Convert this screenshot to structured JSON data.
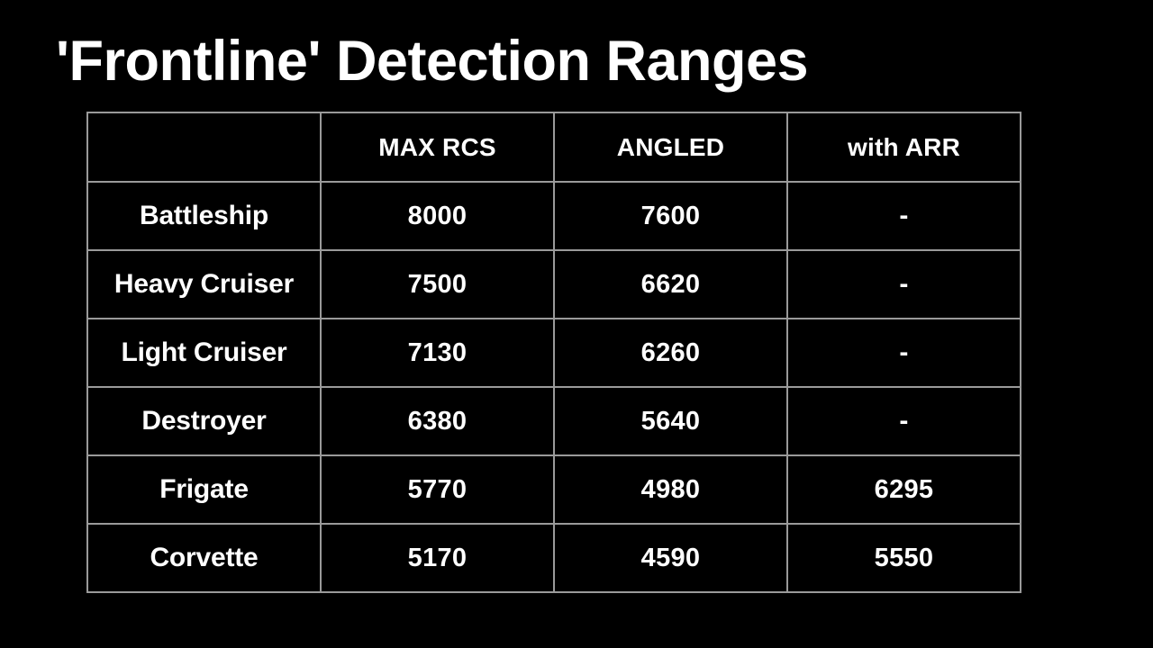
{
  "slide": {
    "title": "'Frontline' Detection Ranges",
    "background_color": "#000000",
    "text_color": "#ffffff",
    "table_border_color": "#9a9a9a"
  },
  "table": {
    "headers": [
      "",
      "MAX RCS",
      "ANGLED",
      "with ARR"
    ],
    "rows": [
      {
        "label": "Battleship",
        "max_rcs": "8000",
        "angled": "7600",
        "with_arr": "-"
      },
      {
        "label": "Heavy Cruiser",
        "max_rcs": "7500",
        "angled": "6620",
        "with_arr": "-"
      },
      {
        "label": "Light Cruiser",
        "max_rcs": "7130",
        "angled": "6260",
        "with_arr": "-"
      },
      {
        "label": "Destroyer",
        "max_rcs": "6380",
        "angled": "5640",
        "with_arr": "-"
      },
      {
        "label": "Frigate",
        "max_rcs": "5770",
        "angled": "4980",
        "with_arr": "6295"
      },
      {
        "label": "Corvette",
        "max_rcs": "5170",
        "angled": "4590",
        "with_arr": "5550"
      }
    ]
  }
}
